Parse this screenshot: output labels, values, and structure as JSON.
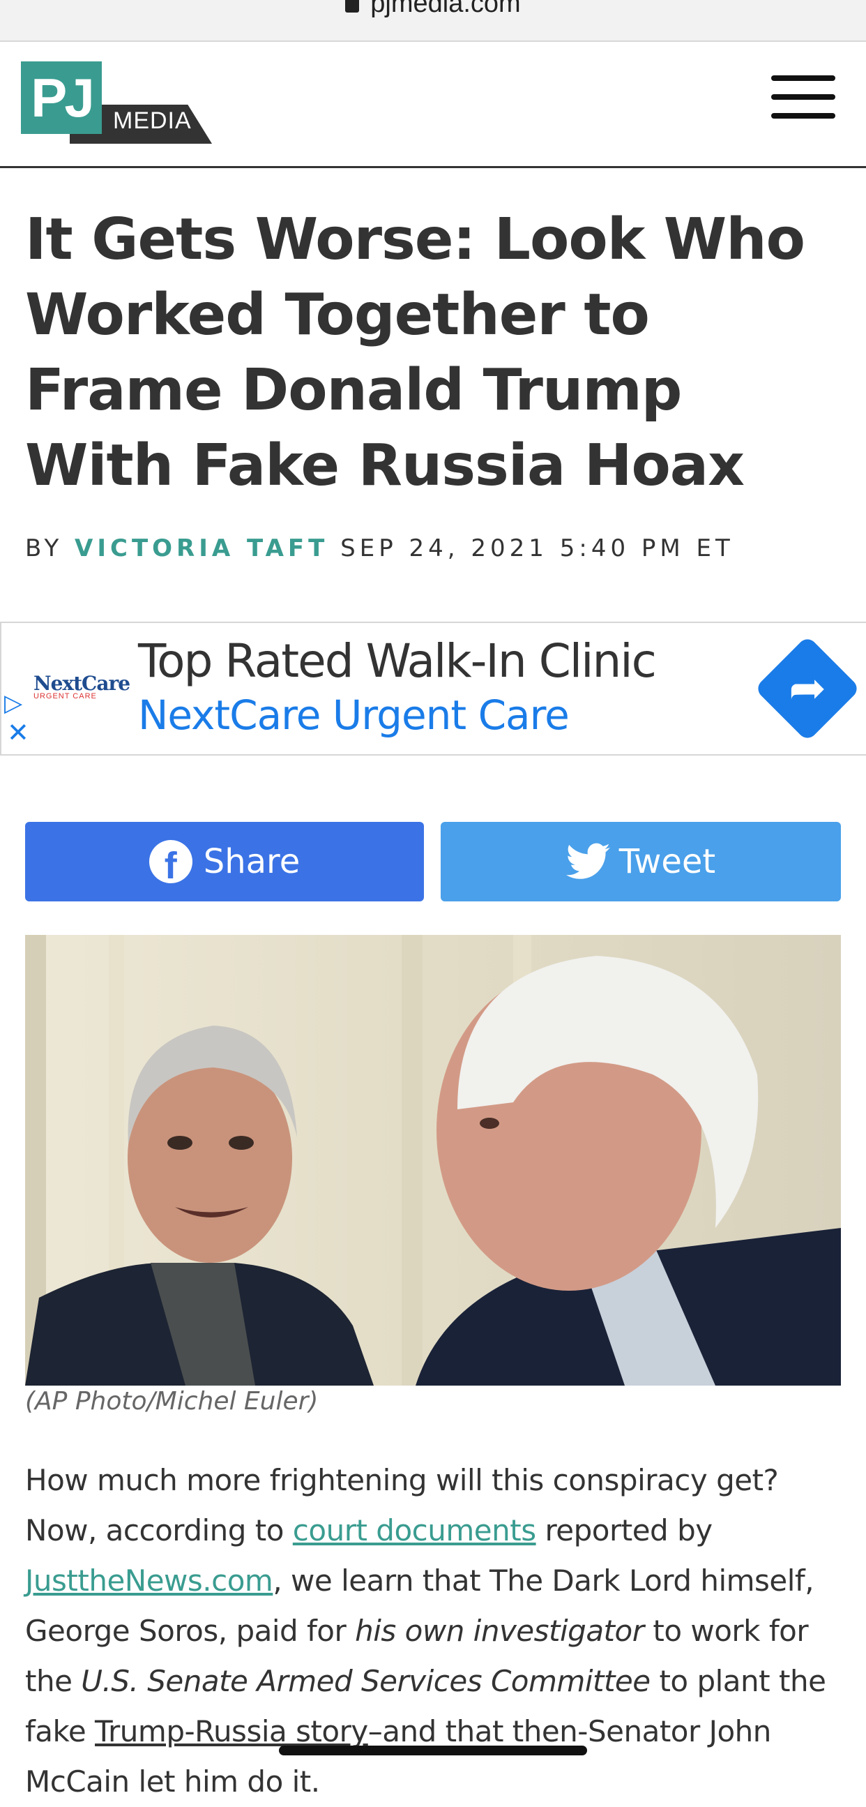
{
  "browser": {
    "url": "pjmedia.com"
  },
  "header": {
    "logo_mark": "PJ",
    "logo_word": "MEDIA"
  },
  "article": {
    "headline": "It Gets Worse: Look Who Worked Together to Frame Donald Trump With Fake Russia Hoax",
    "byline_prefix": "BY",
    "author": "VICTORIA TAFT",
    "date": "SEP 24, 2021 5:40 PM ET",
    "photo_caption": "(AP Photo/Michel Euler)",
    "body": {
      "p1": "How much more frightening will this conspiracy get? ",
      "p2": " Now, according to ",
      "link1": "court documents",
      "p3": " reported by ",
      "link2": "JusttheNews.com",
      "p4": ", we learn that The Dark Lord himself, George Soros, paid for ",
      "em1": "his own investigator",
      "p5": " to work for the ",
      "em2": "U.S. Senate Armed Services Committee",
      "p6": " to plant the fake ",
      "link3": "Trump-Russia story",
      "p7": "–and that then-Senator John McCain let him do it."
    }
  },
  "ad": {
    "logo_name": "NextCare",
    "logo_tag": "URGENT CARE",
    "title": "Top Rated Walk-In Clinic",
    "subtitle": "NextCare Urgent Care"
  },
  "share": {
    "facebook_label": "Share",
    "twitter_label": "Tweet"
  },
  "colors": {
    "accent": "#3a9c90",
    "facebook": "#3b73e6",
    "twitter": "#4aa0ea",
    "ad_blue": "#1a7ce8"
  }
}
